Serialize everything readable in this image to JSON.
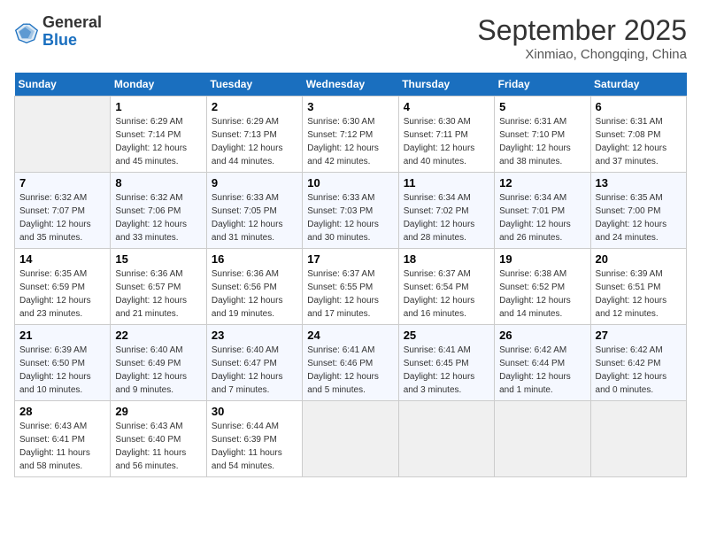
{
  "logo": {
    "general": "General",
    "blue": "Blue"
  },
  "header": {
    "month": "September 2025",
    "location": "Xinmiao, Chongqing, China"
  },
  "weekdays": [
    "Sunday",
    "Monday",
    "Tuesday",
    "Wednesday",
    "Thursday",
    "Friday",
    "Saturday"
  ],
  "weeks": [
    [
      {
        "day": "",
        "info": ""
      },
      {
        "day": "1",
        "info": "Sunrise: 6:29 AM\nSunset: 7:14 PM\nDaylight: 12 hours\nand 45 minutes."
      },
      {
        "day": "2",
        "info": "Sunrise: 6:29 AM\nSunset: 7:13 PM\nDaylight: 12 hours\nand 44 minutes."
      },
      {
        "day": "3",
        "info": "Sunrise: 6:30 AM\nSunset: 7:12 PM\nDaylight: 12 hours\nand 42 minutes."
      },
      {
        "day": "4",
        "info": "Sunrise: 6:30 AM\nSunset: 7:11 PM\nDaylight: 12 hours\nand 40 minutes."
      },
      {
        "day": "5",
        "info": "Sunrise: 6:31 AM\nSunset: 7:10 PM\nDaylight: 12 hours\nand 38 minutes."
      },
      {
        "day": "6",
        "info": "Sunrise: 6:31 AM\nSunset: 7:08 PM\nDaylight: 12 hours\nand 37 minutes."
      }
    ],
    [
      {
        "day": "7",
        "info": "Sunrise: 6:32 AM\nSunset: 7:07 PM\nDaylight: 12 hours\nand 35 minutes."
      },
      {
        "day": "8",
        "info": "Sunrise: 6:32 AM\nSunset: 7:06 PM\nDaylight: 12 hours\nand 33 minutes."
      },
      {
        "day": "9",
        "info": "Sunrise: 6:33 AM\nSunset: 7:05 PM\nDaylight: 12 hours\nand 31 minutes."
      },
      {
        "day": "10",
        "info": "Sunrise: 6:33 AM\nSunset: 7:03 PM\nDaylight: 12 hours\nand 30 minutes."
      },
      {
        "day": "11",
        "info": "Sunrise: 6:34 AM\nSunset: 7:02 PM\nDaylight: 12 hours\nand 28 minutes."
      },
      {
        "day": "12",
        "info": "Sunrise: 6:34 AM\nSunset: 7:01 PM\nDaylight: 12 hours\nand 26 minutes."
      },
      {
        "day": "13",
        "info": "Sunrise: 6:35 AM\nSunset: 7:00 PM\nDaylight: 12 hours\nand 24 minutes."
      }
    ],
    [
      {
        "day": "14",
        "info": "Sunrise: 6:35 AM\nSunset: 6:59 PM\nDaylight: 12 hours\nand 23 minutes."
      },
      {
        "day": "15",
        "info": "Sunrise: 6:36 AM\nSunset: 6:57 PM\nDaylight: 12 hours\nand 21 minutes."
      },
      {
        "day": "16",
        "info": "Sunrise: 6:36 AM\nSunset: 6:56 PM\nDaylight: 12 hours\nand 19 minutes."
      },
      {
        "day": "17",
        "info": "Sunrise: 6:37 AM\nSunset: 6:55 PM\nDaylight: 12 hours\nand 17 minutes."
      },
      {
        "day": "18",
        "info": "Sunrise: 6:37 AM\nSunset: 6:54 PM\nDaylight: 12 hours\nand 16 minutes."
      },
      {
        "day": "19",
        "info": "Sunrise: 6:38 AM\nSunset: 6:52 PM\nDaylight: 12 hours\nand 14 minutes."
      },
      {
        "day": "20",
        "info": "Sunrise: 6:39 AM\nSunset: 6:51 PM\nDaylight: 12 hours\nand 12 minutes."
      }
    ],
    [
      {
        "day": "21",
        "info": "Sunrise: 6:39 AM\nSunset: 6:50 PM\nDaylight: 12 hours\nand 10 minutes."
      },
      {
        "day": "22",
        "info": "Sunrise: 6:40 AM\nSunset: 6:49 PM\nDaylight: 12 hours\nand 9 minutes."
      },
      {
        "day": "23",
        "info": "Sunrise: 6:40 AM\nSunset: 6:47 PM\nDaylight: 12 hours\nand 7 minutes."
      },
      {
        "day": "24",
        "info": "Sunrise: 6:41 AM\nSunset: 6:46 PM\nDaylight: 12 hours\nand 5 minutes."
      },
      {
        "day": "25",
        "info": "Sunrise: 6:41 AM\nSunset: 6:45 PM\nDaylight: 12 hours\nand 3 minutes."
      },
      {
        "day": "26",
        "info": "Sunrise: 6:42 AM\nSunset: 6:44 PM\nDaylight: 12 hours\nand 1 minute."
      },
      {
        "day": "27",
        "info": "Sunrise: 6:42 AM\nSunset: 6:42 PM\nDaylight: 12 hours\nand 0 minutes."
      }
    ],
    [
      {
        "day": "28",
        "info": "Sunrise: 6:43 AM\nSunset: 6:41 PM\nDaylight: 11 hours\nand 58 minutes."
      },
      {
        "day": "29",
        "info": "Sunrise: 6:43 AM\nSunset: 6:40 PM\nDaylight: 11 hours\nand 56 minutes."
      },
      {
        "day": "30",
        "info": "Sunrise: 6:44 AM\nSunset: 6:39 PM\nDaylight: 11 hours\nand 54 minutes."
      },
      {
        "day": "",
        "info": ""
      },
      {
        "day": "",
        "info": ""
      },
      {
        "day": "",
        "info": ""
      },
      {
        "day": "",
        "info": ""
      }
    ]
  ]
}
